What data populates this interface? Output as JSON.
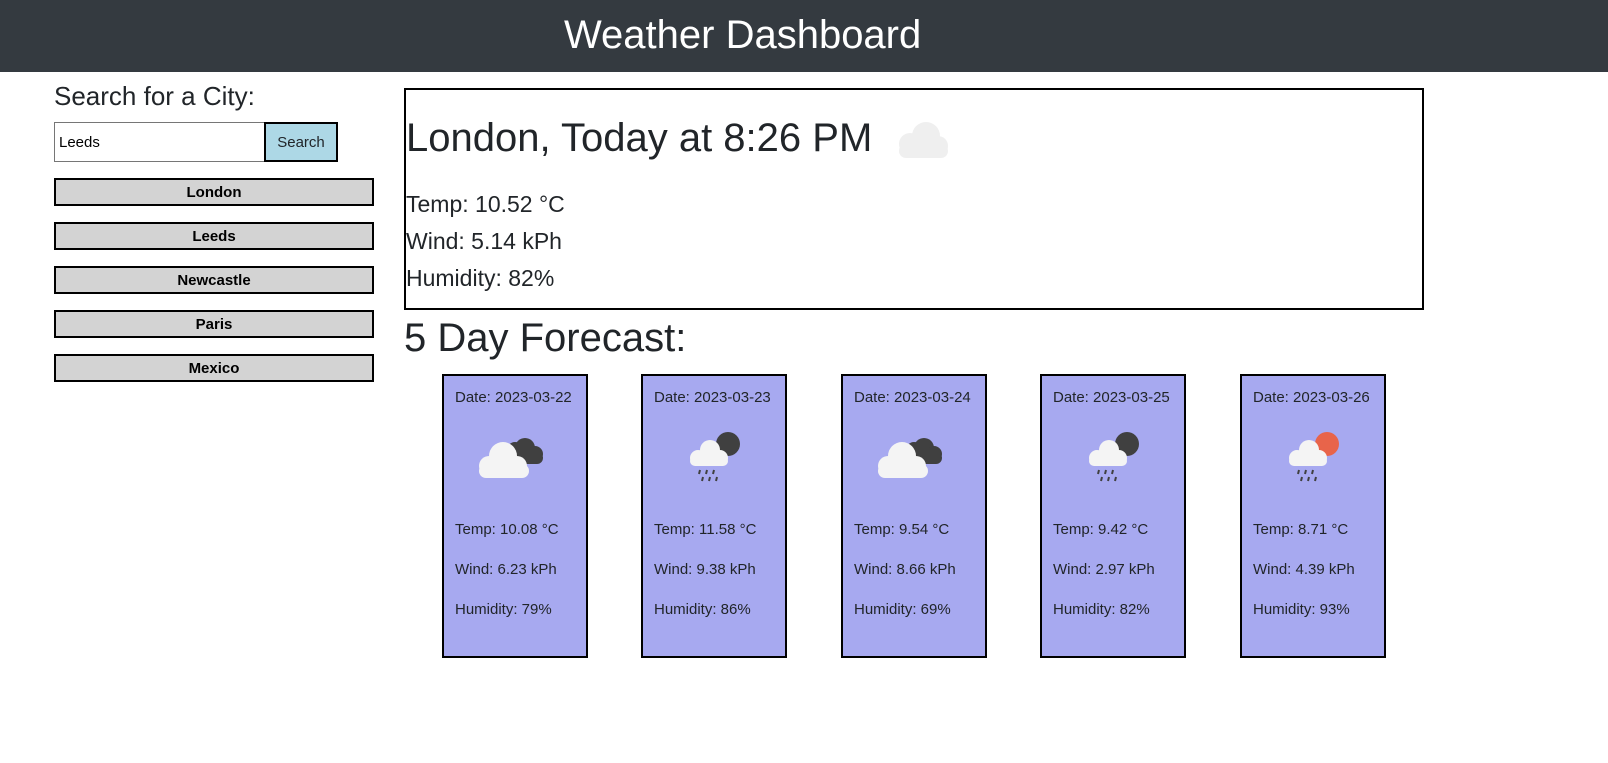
{
  "header": {
    "title": "Weather Dashboard"
  },
  "search": {
    "label": "Search for a City:",
    "input_value": "Leeds",
    "button_label": "Search"
  },
  "history": [
    "London",
    "Leeds",
    "Newcastle",
    "Paris",
    "Mexico"
  ],
  "current": {
    "title": "London, Today at 8:26 PM",
    "icon": "cloud-icon",
    "temp": "Temp: 10.52 °C",
    "wind": "Wind: 5.14 kPh",
    "humidity": "Humidity: 82%"
  },
  "forecast": {
    "title": "5 Day Forecast:",
    "days": [
      {
        "date": "Date: 2023-03-22",
        "icon": "broken-clouds-icon",
        "temp": "Temp: 10.08 °C",
        "wind": "Wind: 6.23 kPh",
        "humidity": "Humidity: 79%"
      },
      {
        "date": "Date: 2023-03-23",
        "icon": "night-rain-icon",
        "temp": "Temp: 11.58 °C",
        "wind": "Wind: 9.38 kPh",
        "humidity": "Humidity: 86%"
      },
      {
        "date": "Date: 2023-03-24",
        "icon": "broken-clouds-icon",
        "temp": "Temp: 9.54 °C",
        "wind": "Wind: 8.66 kPh",
        "humidity": "Humidity: 69%"
      },
      {
        "date": "Date: 2023-03-25",
        "icon": "night-rain-icon",
        "temp": "Temp: 9.42 °C",
        "wind": "Wind: 2.97 kPh",
        "humidity": "Humidity: 82%"
      },
      {
        "date": "Date: 2023-03-26",
        "icon": "day-rain-icon",
        "temp": "Temp: 8.71 °C",
        "wind": "Wind: 4.39 kPh",
        "humidity": "Humidity: 93%"
      }
    ]
  },
  "colors": {
    "header_bg": "#343a40",
    "search_button": "#add8e6",
    "history_button": "#d3d3d3",
    "card_bg": "#a7a9f0",
    "sun": "#e8644a"
  }
}
